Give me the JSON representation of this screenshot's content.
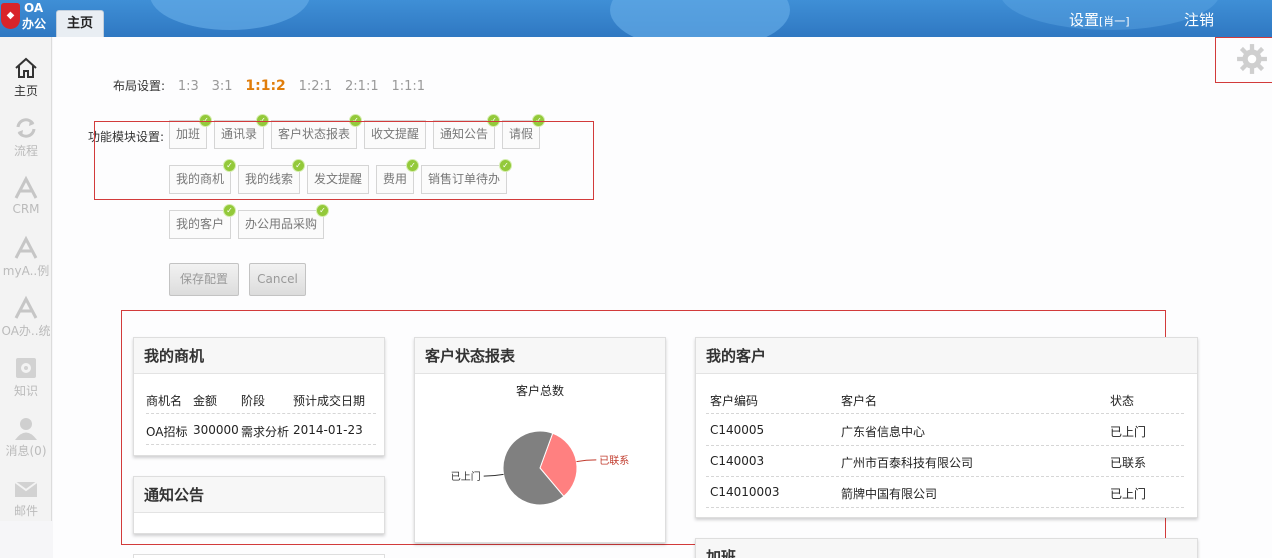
{
  "header": {
    "logo_line1": "OA",
    "logo_line2": "办公",
    "tab": "主页",
    "settings": "设置",
    "settings_sub": "[肖一]",
    "logout": "注销"
  },
  "sidebar": {
    "items": [
      {
        "label": "主页",
        "icon": "home-icon",
        "active": true
      },
      {
        "label": "流程",
        "icon": "refresh-icon"
      },
      {
        "label": "CRM",
        "icon": "crm-icon"
      },
      {
        "label": "myA..例",
        "icon": "app-icon"
      },
      {
        "label": "OA办..统",
        "icon": "app-icon"
      },
      {
        "label": "知识",
        "icon": "knowledge-icon"
      },
      {
        "label": "消息(0)",
        "icon": "user-icon"
      },
      {
        "label": "邮件",
        "icon": "mail-icon"
      }
    ]
  },
  "layout_settings": {
    "label": "布局设置:",
    "options": [
      "1:3",
      "3:1",
      "1:1:2",
      "1:2:1",
      "2:1:1",
      "1:1:1"
    ],
    "selected": "1:1:2"
  },
  "module_settings": {
    "label": "功能模块设置:",
    "modules": [
      "加班",
      "通讯录",
      "客户状态报表",
      "收文提醒",
      "通知公告",
      "请假",
      "我的商机",
      "我的线索",
      "发文提醒",
      "费用",
      "销售订单待办",
      "我的客户",
      "办公用品采购"
    ]
  },
  "buttons": {
    "save": "保存配置",
    "cancel": "Cancel"
  },
  "opportunities": {
    "title": "我的商机",
    "columns": [
      "商机名",
      "金额",
      "阶段",
      "预计成交日期"
    ],
    "rows": [
      [
        "OA招标",
        "300000",
        "需求分析",
        "2014-01-23"
      ]
    ]
  },
  "notice": {
    "title": "通知公告"
  },
  "customer_report": {
    "title": "客户状态报表",
    "chart_data": {
      "type": "pie",
      "title": "客户总数",
      "slices": [
        {
          "label": "已上门",
          "value": 2,
          "color": "#808080"
        },
        {
          "label": "已联系",
          "value": 1,
          "color": "#ff8080"
        }
      ]
    }
  },
  "customers": {
    "title": "我的客户",
    "columns": [
      "客户编码",
      "客户名",
      "状态"
    ],
    "rows": [
      [
        "C140005",
        "广东省信息中心",
        "已上门"
      ],
      [
        "C140003",
        "广州市百泰科技有限公司",
        "已联系"
      ],
      [
        "C14010003",
        "箭牌中国有限公司",
        "已上门"
      ]
    ]
  },
  "overtime": {
    "title": "加班"
  }
}
